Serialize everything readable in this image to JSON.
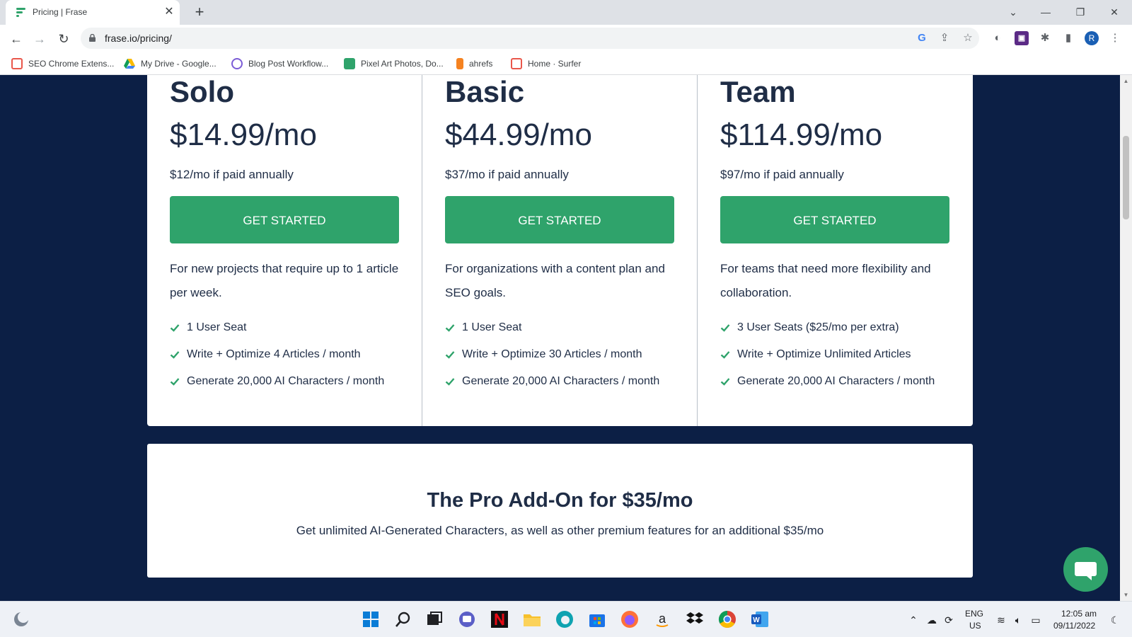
{
  "browser": {
    "tab_title": "Pricing | Frase",
    "new_tab": "+",
    "url": "frase.io/pricing/",
    "bookmarks": [
      {
        "label": "SEO Chrome Extens...",
        "color": "#e9574b"
      },
      {
        "label": "My Drive - Google...",
        "color": "#fbbc04"
      },
      {
        "label": "Blog Post Workflow...",
        "color": "#7b5cd6"
      },
      {
        "label": "Pixel Art Photos, Do...",
        "color": "#2fa36b"
      },
      {
        "label": "ahrefs",
        "color": "#f58220"
      },
      {
        "label": "Home · Surfer",
        "color": "#e9574b"
      }
    ],
    "profile_initial": "R"
  },
  "plans": [
    {
      "name": "Solo",
      "price": "$14.99/mo",
      "annual": "$12/mo if paid annually",
      "cta": "GET STARTED",
      "description": "For new projects that require up to 1 article per week.",
      "features": [
        "1 User Seat",
        "Write + Optimize 4 Articles / month",
        "Generate 20,000 AI Characters / month"
      ]
    },
    {
      "name": "Basic",
      "price": "$44.99/mo",
      "annual": "$37/mo if paid annually",
      "cta": "GET STARTED",
      "description": "For organizations with a content plan and SEO goals.",
      "features": [
        "1 User Seat",
        "Write + Optimize 30 Articles / month",
        "Generate 20,000 AI Characters / month"
      ]
    },
    {
      "name": "Team",
      "price": "$114.99/mo",
      "annual": "$97/mo if paid annually",
      "cta": "GET STARTED",
      "description": "For teams that need more flexibility and collaboration.",
      "features": [
        "3 User Seats ($25/mo per extra)",
        "Write + Optimize Unlimited Articles",
        "Generate 20,000 AI Characters / month"
      ]
    }
  ],
  "addon": {
    "title": "The Pro Add-On for $35/mo",
    "subtitle": "Get unlimited AI-Generated Characters, as well as other premium features for an additional $35/mo"
  },
  "colors": {
    "page_background": "#0c1f45",
    "accent_green": "#2fa36b",
    "text_dark": "#1f2d46"
  },
  "taskbar": {
    "lang_line1": "ENG",
    "lang_line2": "US",
    "time": "12:05 am",
    "date": "09/11/2022",
    "apps": [
      "start-icon",
      "search-icon",
      "task-view-icon",
      "teams-chat-icon",
      "netflix-icon",
      "file-explorer-icon",
      "edge-icon",
      "store-icon",
      "firefox-icon",
      "amazon-icon",
      "dropbox-icon",
      "chrome-icon",
      "word-icon"
    ]
  }
}
